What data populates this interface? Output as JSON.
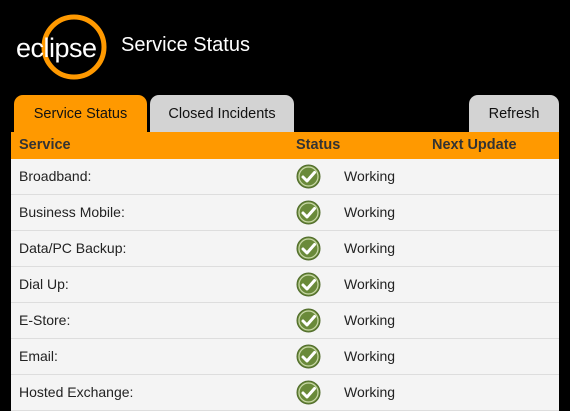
{
  "brand": {
    "logo_text": "eclipse",
    "accent": "#ff9900"
  },
  "header": {
    "title": "Service Status"
  },
  "tabs": [
    {
      "label": "Service Status",
      "active": true
    },
    {
      "label": "Closed Incidents",
      "active": false
    }
  ],
  "refresh_label": "Refresh",
  "table": {
    "columns": [
      "Service",
      "Status",
      "Next Update"
    ],
    "rows": [
      {
        "service": "Broadband:",
        "status": "Working",
        "icon": "check-icon"
      },
      {
        "service": "Business Mobile:",
        "status": "Working",
        "icon": "check-icon"
      },
      {
        "service": "Data/PC Backup:",
        "status": "Working",
        "icon": "check-icon"
      },
      {
        "service": "Dial Up:",
        "status": "Working",
        "icon": "check-icon"
      },
      {
        "service": "E-Store:",
        "status": "Working",
        "icon": "check-icon"
      },
      {
        "service": "Email:",
        "status": "Working",
        "icon": "check-icon"
      },
      {
        "service": "Hosted Exchange:",
        "status": "Working",
        "icon": "check-icon"
      }
    ]
  },
  "colors": {
    "status_ok": "#6a8a3a",
    "tab_inactive": "#d3d3d3",
    "header_bg": "#000000"
  }
}
